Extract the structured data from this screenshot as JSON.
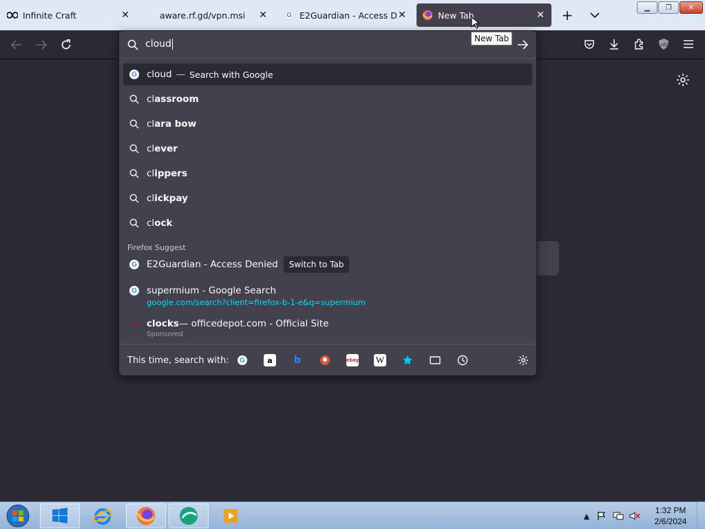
{
  "tabs": [
    {
      "title": "Infinite Craft",
      "icon": "infinity-icon"
    },
    {
      "title": "aware.rf.gd/vpn.msi",
      "icon": "none"
    },
    {
      "title": "E2Guardian - Access Denied",
      "icon": "google-icon"
    },
    {
      "title": "New Tab",
      "icon": "firefox-icon",
      "active": true
    }
  ],
  "tooltip": "New Tab",
  "urlbar": {
    "typed": "cloud",
    "heuristic": {
      "text": "cloud",
      "sep": "—",
      "action": "Search with Google"
    },
    "suggestions": [
      {
        "prefix": "cl",
        "rest": "assroom"
      },
      {
        "prefix": "cl",
        "rest": "ara bow"
      },
      {
        "prefix": "cl",
        "rest": "ever"
      },
      {
        "prefix": "cl",
        "rest": "ippers"
      },
      {
        "prefix": "cl",
        "rest": "ickpay"
      },
      {
        "prefix": "cl",
        "rest": "ock"
      }
    ],
    "group_label": "Firefox Suggest",
    "tab_result": {
      "title": "E2Guardian - Access Denied",
      "button": "Switch to Tab"
    },
    "history_result": {
      "title": "supermium - Google Search",
      "url": "google.com/search?client=firefox-b-1-e&q=supermium"
    },
    "sponsored_result": {
      "bold": "clocks",
      "rest": " — officedepot.com - Official Site",
      "label": "Sponsored"
    },
    "search_with_label": "This time, search with:"
  },
  "taskbar": {
    "time": "1:32 PM",
    "date": "2/6/2024"
  },
  "colors": {
    "accent": "#00ddff",
    "panel": "#42414d",
    "background": "#2b2a33"
  }
}
